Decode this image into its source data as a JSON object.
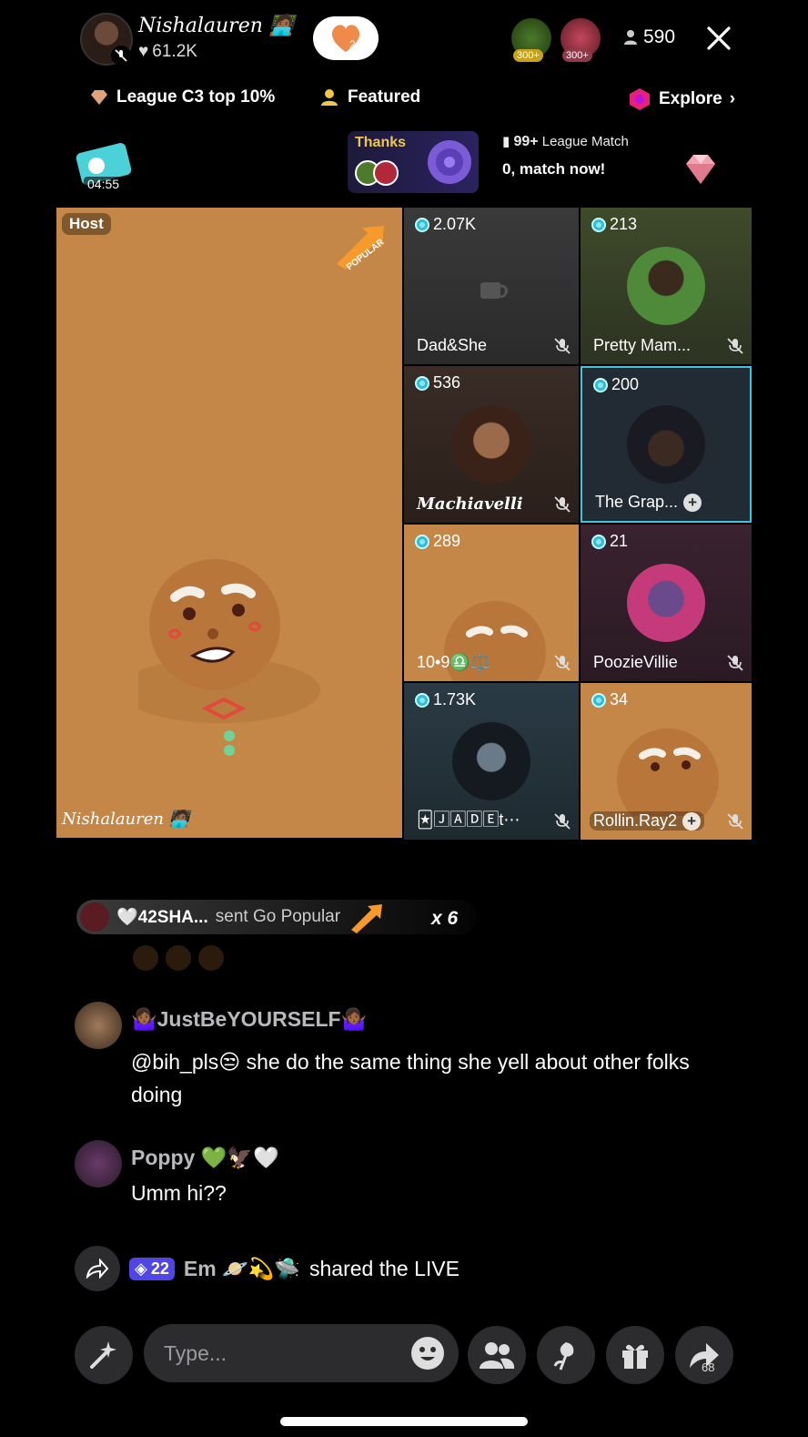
{
  "header": {
    "host_name": "Nishalauren 🧑🏾‍💻",
    "host_likes": "61.2K",
    "follow_count": "2",
    "top_gifters": [
      {
        "badge": "300+",
        "color": "#c8a21a"
      },
      {
        "badge": "300+",
        "color": "#8e3a4a"
      }
    ],
    "viewer_count": "590"
  },
  "info_row": {
    "league": "League C3 top 10%",
    "featured": "Featured",
    "explore": "Explore"
  },
  "promo": {
    "timer": "04:55",
    "thanks_label": "Thanks",
    "league_count": "99+",
    "league_label": "League Match",
    "match_text": "0, match now!"
  },
  "host_tile": {
    "label": "Host",
    "badge": "POPULAR",
    "watermark": "Nishalauren 🧑🏾‍💻"
  },
  "guests": [
    {
      "score": "2.07K",
      "name": "Dad&She",
      "muted": true
    },
    {
      "score": "213",
      "name": "Pretty Mam...",
      "muted": true
    },
    {
      "score": "536",
      "name": "Machiavelli",
      "muted": true
    },
    {
      "score": "200",
      "name": "The Grap...",
      "muted": false
    },
    {
      "score": "289",
      "name": "10•9♎️⚖️",
      "muted": true
    },
    {
      "score": "21",
      "name": "PoozieVillie",
      "muted": true
    },
    {
      "score": "1.73K",
      "name": "🃏🄹🄰🄳🄴t⋯",
      "muted": true
    },
    {
      "score": "34",
      "name": "Rollin.Ray2",
      "muted": true
    }
  ],
  "gift": {
    "sender": "🤍42SHA...",
    "text": "sent Go Popular",
    "count": "x 6"
  },
  "comments": [
    {
      "user": "🤷🏾‍♀️JustBeYOURSELF🤷🏾‍♀️",
      "text": "@bih_pls😒 she do the same thing she yell about other folks doing"
    },
    {
      "user": "Poppy 💚🦅🤍",
      "text": "Umm hi??"
    }
  ],
  "share_event": {
    "level": "22",
    "user": "Em 🪐💫🛸",
    "text": "shared the LIVE"
  },
  "input": {
    "placeholder": "Type..."
  },
  "share_count": "68",
  "colors": {
    "tile_orange": "#c48747",
    "highlight_border": "#3ec6e0",
    "level_badge": "#4f46e5"
  }
}
